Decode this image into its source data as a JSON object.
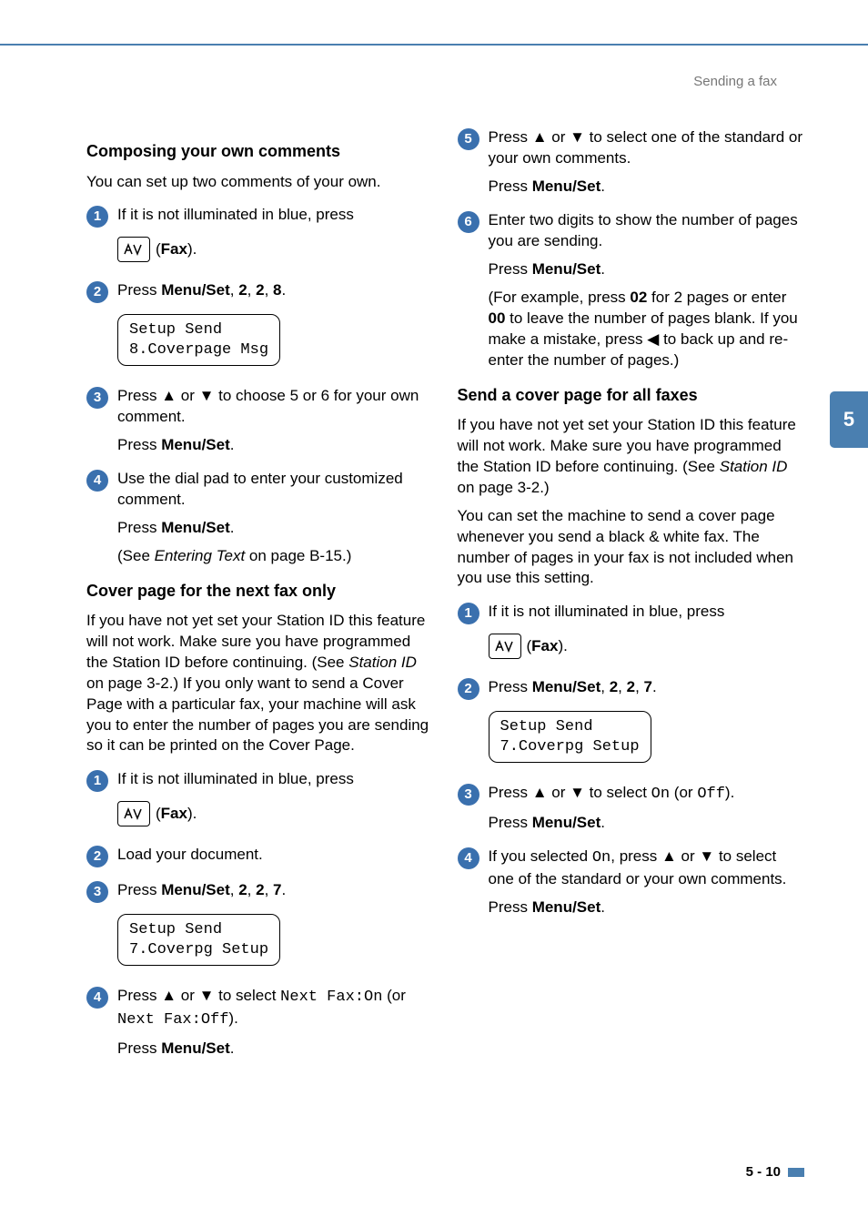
{
  "header": {
    "section": "Sending a fax"
  },
  "chapter_tab": "5",
  "page_number": "5 - 10",
  "left": {
    "h_compose": "Composing your own comments",
    "p_compose_intro": "You can set up two comments of your own.",
    "s1": {
      "num": "1",
      "text": "If it is not illuminated in blue, press"
    },
    "fax_label": "Fax",
    "fax_paren_close": ").",
    "s2": {
      "num": "2",
      "pre": "Press ",
      "b1": "Menu/Set",
      "mid1": ", ",
      "b2": "2",
      "mid2": ", ",
      "b3": "2",
      "mid3": ", ",
      "b4": "8",
      "post": "."
    },
    "lcd1_line1": "Setup Send",
    "lcd1_line2": "8.Coverpage Msg",
    "s3": {
      "num": "3",
      "text_a": "Press ",
      "text_b": " or ",
      "text_c": " to choose 5 or 6 for your own comment."
    },
    "s3_sub": {
      "a": "Press ",
      "b": "Menu/Set",
      "c": "."
    },
    "s4": {
      "num": "4",
      "text": "Use the dial pad to enter your customized comment."
    },
    "s4_sub1": {
      "a": "Press ",
      "b": "Menu/Set",
      "c": "."
    },
    "s4_sub2": {
      "a": "(See ",
      "i": "Entering Text",
      "b": " on page B-15.)"
    },
    "h_next": "Cover page for the next fax only",
    "p_next": {
      "a": "If you have not yet set your Station ID this feature will not work. Make sure you have programmed the Station ID before continuing. (See ",
      "i": "Station ID",
      "b": " on page 3-2.) If you only want to send a Cover Page with a particular fax, your machine will ask you to enter the number of pages you are sending so it can be printed on the Cover Page."
    },
    "n_s1": {
      "num": "1",
      "text": "If it is not illuminated in blue, press"
    },
    "n_s2": {
      "num": "2",
      "text": "Load your document."
    },
    "n_s3": {
      "num": "3",
      "pre": "Press ",
      "b1": "Menu/Set",
      "mid1": ", ",
      "b2": "2",
      "mid2": ", ",
      "b3": "2",
      "mid3": ", ",
      "b4": "7",
      "post": "."
    },
    "lcd2_line1": "Setup Send",
    "lcd2_line2": "7.Coverpg Setup",
    "n_s4": {
      "num": "4",
      "a": "Press ",
      "b": " or ",
      "c": " to select ",
      "m1": "Next Fax:On",
      "d": " (or ",
      "m2": "Next Fax:Off",
      "e": ")."
    },
    "n_s4_sub": {
      "a": "Press ",
      "b": "Menu/Set",
      "c": "."
    }
  },
  "right": {
    "s5": {
      "num": "5",
      "a": "Press ",
      "b": " or ",
      "c": " to select one of the standard or your own comments."
    },
    "s5_sub": {
      "a": "Press ",
      "b": "Menu/Set",
      "c": "."
    },
    "s6": {
      "num": "6",
      "a": "Enter two digits to show the number of pages you are sending."
    },
    "s6_sub": {
      "a": "Press ",
      "b": "Menu/Set",
      "c": "."
    },
    "s6_para": {
      "a": "(For example, press ",
      "b1": "02",
      "b": " for 2 pages or enter ",
      "b2": "00",
      "c": " to leave the number of pages blank. If you make a mistake, press ",
      "d": " to back up and re-enter the number of pages.)"
    },
    "h_all": "Send a cover page for all faxes",
    "p_all1": {
      "a": "If you have not yet set your Station ID this feature will not work. Make sure you have programmed the Station ID before continuing. (See ",
      "i": "Station ID",
      "b": " on page 3-2.)"
    },
    "p_all2": "You can set the machine to send a cover page whenever you send a black & white fax. The number of pages in your fax is not included when you use this setting.",
    "a_s1": {
      "num": "1",
      "text": "If it is not illuminated in blue, press"
    },
    "a_s2": {
      "num": "2",
      "pre": "Press ",
      "b1": "Menu/Set",
      "mid1": ", ",
      "b2": "2",
      "mid2": ", ",
      "b3": "2",
      "mid3": ", ",
      "b4": "7",
      "post": "."
    },
    "lcd3_line1": "Setup Send",
    "lcd3_line2": "7.Coverpg Setup",
    "a_s3": {
      "num": "3",
      "a": "Press ",
      "b": " or ",
      "c": " to select ",
      "m1": "On",
      "d": " (or ",
      "m2": "Off",
      "e": ")."
    },
    "a_s3_sub": {
      "a": "Press ",
      "b": "Menu/Set",
      "c": "."
    },
    "a_s4": {
      "num": "4",
      "a": "If you selected ",
      "m1": "On",
      "b": ", press ",
      "c": " or ",
      "d": " to select one of the standard or your own comments."
    },
    "a_s4_sub": {
      "a": "Press ",
      "b": "Menu/Set",
      "c": "."
    }
  }
}
